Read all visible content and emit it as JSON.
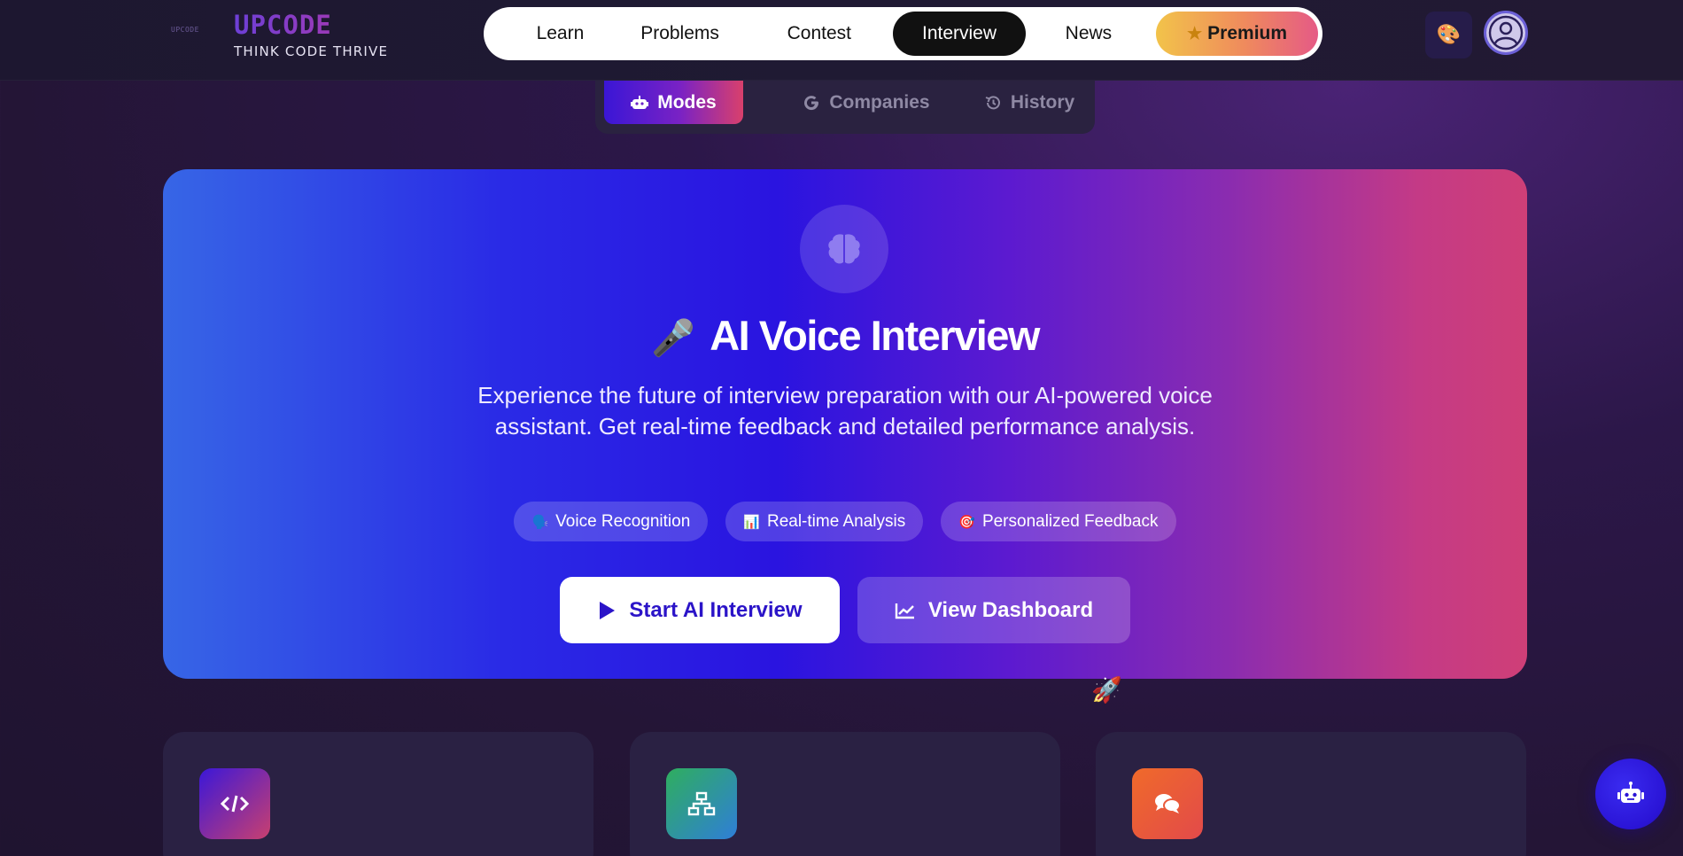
{
  "brand": {
    "mark_text": "UPCODE",
    "title": "UPCODE",
    "tagline": "THINK CODE THRIVE"
  },
  "nav": {
    "items": [
      {
        "label": "Learn",
        "icon": ""
      },
      {
        "label": "Problems",
        "icon": ""
      },
      {
        "label": "Contest",
        "icon": ""
      },
      {
        "label": "Interview",
        "icon": "",
        "active": true
      },
      {
        "label": "News",
        "icon": ""
      },
      {
        "label": "Premium",
        "icon": "star-icon"
      }
    ]
  },
  "header_actions": {
    "theme_icon": "palette-icon",
    "profile_icon": "user-avatar-icon"
  },
  "subtabs": [
    {
      "label": "Modes",
      "icon": "robot-icon",
      "active": true
    },
    {
      "label": "Companies",
      "icon": "google-icon"
    },
    {
      "label": "History",
      "icon": "history-icon"
    }
  ],
  "hero": {
    "icon": "brain-icon",
    "title_emoji": "🎤",
    "title": "AI Voice Interview",
    "description": "Experience the future of interview preparation with our AI-powered voice assistant. Get real-time feedback and detailed performance analysis.",
    "features": [
      {
        "emoji": "🗣️",
        "label": "Voice Recognition"
      },
      {
        "emoji": "📊",
        "label": "Real-time Analysis"
      },
      {
        "emoji": "🎯",
        "label": "Personalized Feedback"
      }
    ],
    "primary_button": "Start AI Interview",
    "secondary_button": "View Dashboard"
  },
  "decor": {
    "rocket": "🚀"
  },
  "cards": [
    {
      "icon": "code-icon"
    },
    {
      "icon": "network-icon"
    },
    {
      "icon": "chat-bubbles-icon"
    }
  ],
  "chatbot": {
    "icon": "robot-icon"
  },
  "colors": {
    "page_bg": "#241536",
    "accent_indigo": "#2a14e0",
    "accent_pink": "#cf3f77",
    "premium_gold": "#f2c34a"
  }
}
